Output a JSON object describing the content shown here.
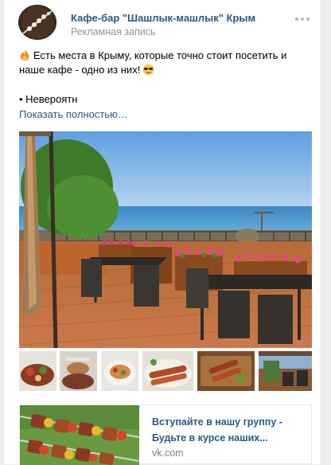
{
  "post": {
    "author": "Кафе-бар \"Шашлык-машлык\" Крым",
    "subtitle": "Рекламная запись",
    "more_icon": "more-horizontal-icon",
    "text_line1": "Есть места в Крыму, которые точно стоит посетить и",
    "text_line2": "наше кафе - одно из них!",
    "bullet": "• Невероятн",
    "show_more": "Показать полностью…"
  },
  "link": {
    "title": "Вступайте в нашу группу - Будьте в курсе наших...",
    "domain": "vk.com"
  },
  "colors": {
    "link_blue": "#2a5885",
    "secondary_text": "#939393",
    "background": "#edeef0"
  }
}
